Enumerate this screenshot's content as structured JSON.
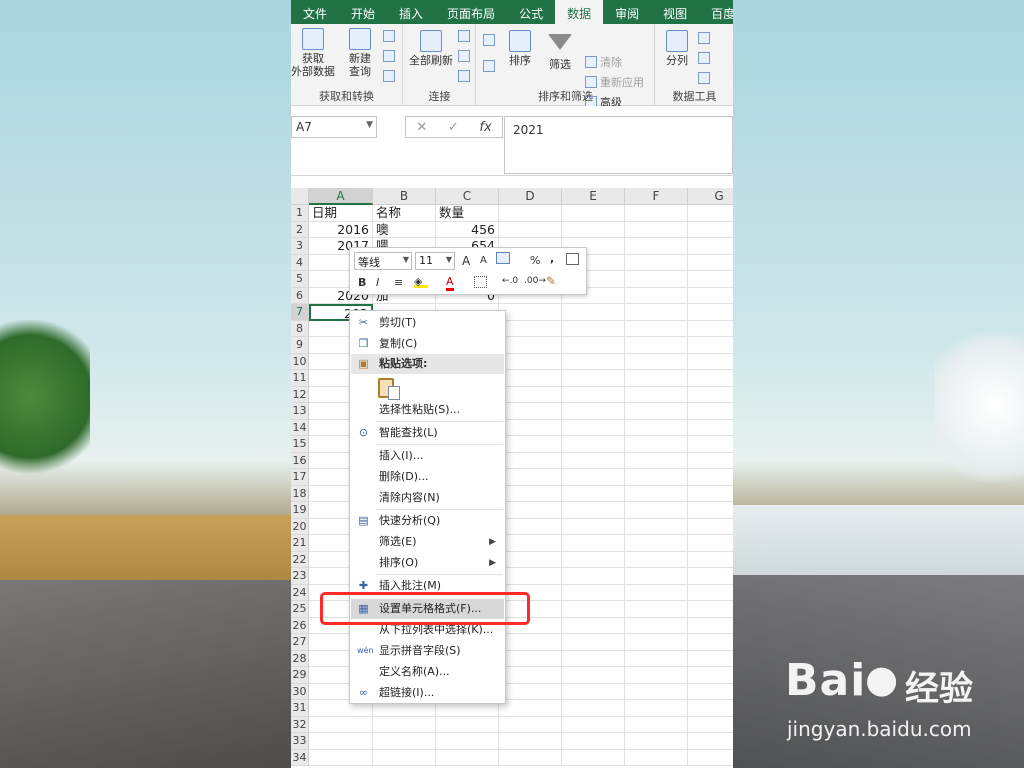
{
  "ribbon": {
    "tabs": [
      "文件",
      "开始",
      "插入",
      "页面布局",
      "公式",
      "数据",
      "审阅",
      "视图",
      "百度网盘"
    ],
    "active_tab": "数据",
    "groups": {
      "get_transform": {
        "label": "获取和转换",
        "get_external_data": "获取\n外部数据",
        "new_query": "新建\n查询"
      },
      "connections": {
        "label": "连接",
        "refresh_all": "全部刷新"
      },
      "sort_filter": {
        "label": "排序和筛选",
        "sort": "排序",
        "filter": "筛选",
        "clear": "清除",
        "reapply": "重新应用",
        "advanced": "高级"
      },
      "data_tools": {
        "label": "数据工具",
        "text_to_columns": "分列"
      }
    }
  },
  "formula_bar": {
    "name_box": "A7",
    "value": "2021",
    "cancel_symbol": "✕",
    "enter_symbol": "✓",
    "fx_symbol": "fx"
  },
  "grid": {
    "columns": [
      "A",
      "B",
      "C",
      "D",
      "E",
      "F",
      "G"
    ],
    "row_numbers": [
      "1",
      "2",
      "3",
      "4",
      "5",
      "6",
      "7",
      "8",
      "9",
      "10",
      "11",
      "12",
      "13",
      "14",
      "15",
      "16",
      "17",
      "18",
      "19",
      "20",
      "21",
      "22",
      "23",
      "24",
      "25",
      "26",
      "27",
      "28",
      "29",
      "30",
      "31",
      "32",
      "33",
      "34"
    ],
    "header_row": [
      "日期",
      "名称",
      "数量"
    ],
    "rows": [
      [
        "2016",
        "噢",
        "456"
      ],
      [
        "2017",
        "喂",
        "654"
      ],
      [
        "2",
        "",
        ""
      ],
      [
        "2",
        "",
        ""
      ],
      [
        "2020",
        "加",
        "0"
      ],
      [
        "202",
        "",
        ""
      ]
    ],
    "active_cell": "A7"
  },
  "mini_toolbar": {
    "font": "等线",
    "size": "11",
    "grow_font": "A",
    "shrink_font": "A",
    "percent": "%",
    "comma": ",",
    "bold": "B",
    "italic": "I",
    "font_color": "A"
  },
  "context_menu": {
    "cut": "剪切(T)",
    "copy": "复制(C)",
    "paste_options": "粘贴选项:",
    "paste_special": "选择性粘贴(S)...",
    "smart_lookup": "智能查找(L)",
    "insert": "插入(I)...",
    "delete": "删除(D)...",
    "clear_contents": "清除内容(N)",
    "quick_analysis": "快速分析(Q)",
    "filter": "筛选(E)",
    "sort": "排序(O)",
    "insert_comment": "插入批注(M)",
    "format_cells": "设置单元格格式(F)...",
    "pick_from_list": "从下拉列表中选择(K)...",
    "show_phonetic": "显示拼音字段(S)",
    "define_name": "定义名称(A)...",
    "hyperlink": "超链接(I)..."
  },
  "watermark": {
    "logo": "Bai",
    "logo_tail": "经验",
    "url": "jingyan.baidu.com"
  },
  "colors": {
    "excel_green": "#217346",
    "highlight_red": "#ff2a2a"
  }
}
